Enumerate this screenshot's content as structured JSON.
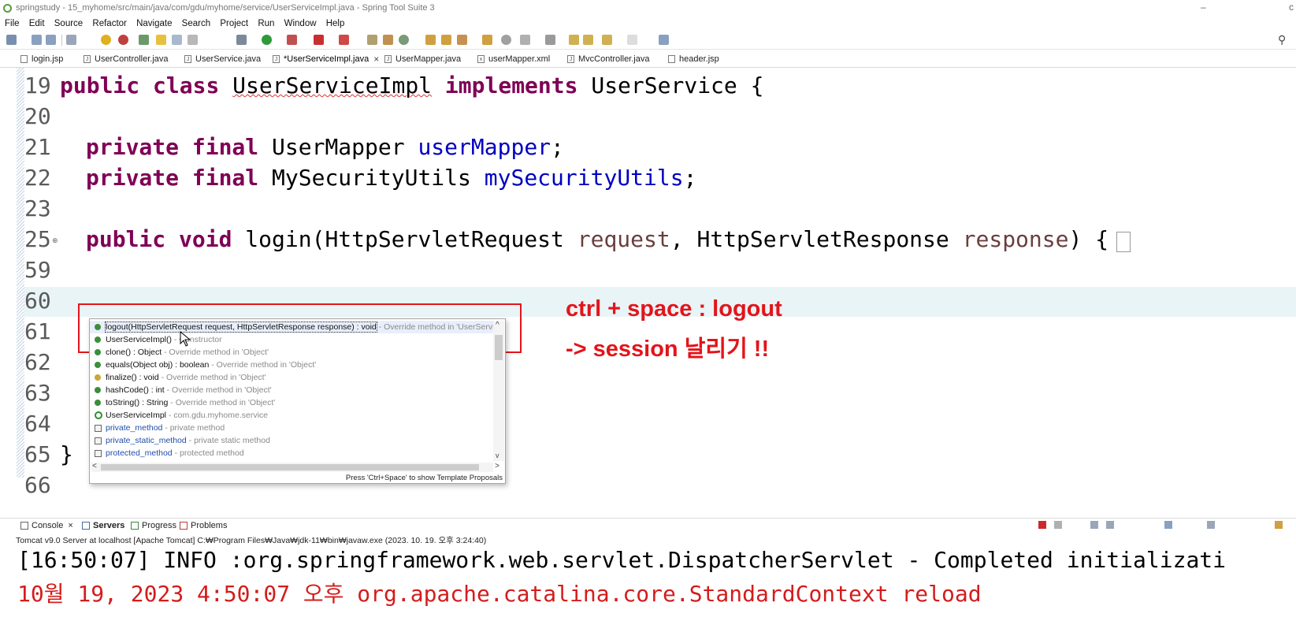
{
  "window": {
    "title": "springstudy - 15_myhome/src/main/java/com/gdu/myhome/service/UserServiceImpl.java - Spring Tool Suite 3",
    "minimize_glyph": "–",
    "restore_glyph": "c"
  },
  "menu": [
    "File",
    "Edit",
    "Source",
    "Refactor",
    "Navigate",
    "Search",
    "Project",
    "Run",
    "Window",
    "Help"
  ],
  "tabs": [
    {
      "label": "login.jsp"
    },
    {
      "label": "UserController.java"
    },
    {
      "label": "UserService.java"
    },
    {
      "label": "*UserServiceImpl.java",
      "close": "×"
    },
    {
      "label": "UserMapper.java"
    },
    {
      "label": "userMapper.xml"
    },
    {
      "label": "MvcController.java"
    },
    {
      "label": "header.jsp"
    }
  ],
  "editor": {
    "lines": [
      {
        "num": "19"
      },
      {
        "num": "20"
      },
      {
        "num": "21"
      },
      {
        "num": "22"
      },
      {
        "num": "23"
      },
      {
        "num": "25"
      },
      {
        "num": "59"
      },
      {
        "num": "60"
      },
      {
        "num": "61"
      },
      {
        "num": "62"
      },
      {
        "num": "63"
      },
      {
        "num": "64"
      },
      {
        "num": "65"
      },
      {
        "num": "66"
      }
    ],
    "code": {
      "l19": {
        "kw1": "public",
        "kw2": "class",
        "cls": "UserServiceImpl",
        "kw3": "implements",
        "rest": "UserService {"
      },
      "l21": {
        "kw": "private final",
        "type": "UserMapper",
        "field": "userMapper",
        "end": ";"
      },
      "l22": {
        "kw": "private final",
        "type": "MySecurityUtils",
        "field": "mySecurityUtils",
        "end": ";"
      },
      "l25": {
        "kw": "public void",
        "m": "login(HttpServletRequest",
        "p1": "request",
        "m2": ", HttpServletResponse",
        "p2": "response",
        "end": ") {"
      },
      "l65": {
        "text": "}"
      }
    }
  },
  "annotation": {
    "line1": "ctrl + space : logout",
    "line2": "-> session 날리기 !!",
    "color": "#e3141a"
  },
  "completion": {
    "items": [
      {
        "text": "logout(HttpServletRequest request, HttpServletResponse response) : void",
        "desc": " - Override method in 'UserService'",
        "icon": "method-override-icon",
        "color": "#3a8f3a"
      },
      {
        "text": "UserServiceImpl()",
        "desc": " - Constructor",
        "icon": "constructor-icon",
        "color": "#3a8f3a"
      },
      {
        "text": "clone() : Object",
        "desc": " - Override method in 'Object'",
        "icon": "method-icon",
        "color": "#3a8f3a"
      },
      {
        "text": "equals(Object obj) : boolean",
        "desc": " - Override method in 'Object'",
        "icon": "method-icon",
        "color": "#3a8f3a"
      },
      {
        "text": "finalize() : void",
        "desc": " - Override method in 'Object'",
        "icon": "method-icon",
        "color": "#c8a83a"
      },
      {
        "text": "hashCode() : int",
        "desc": " - Override method in 'Object'",
        "icon": "method-icon",
        "color": "#3a8f3a"
      },
      {
        "text": "toString() : String",
        "desc": " - Override method in 'Object'",
        "icon": "method-icon",
        "color": "#3a8f3a"
      },
      {
        "text": "UserServiceImpl",
        "desc": " - com.gdu.myhome.service",
        "icon": "class-icon",
        "color": "#2f8f2f"
      },
      {
        "text": "private_method",
        "desc": " - private method",
        "icon": "template-icon",
        "color": "#999999"
      },
      {
        "text": "private_static_method",
        "desc": " - private static method",
        "icon": "template-icon",
        "color": "#999999"
      },
      {
        "text": "protected_method",
        "desc": " - protected method",
        "icon": "template-icon",
        "color": "#999999"
      }
    ],
    "hint": "Press 'Ctrl+Space' to show Template Proposals",
    "scroll_up": "^",
    "scroll_down": "v",
    "scroll_left": "<",
    "scroll_right": ">"
  },
  "console": {
    "tabs": [
      {
        "label": "Console"
      },
      {
        "label": "Servers"
      },
      {
        "label": "Progress"
      },
      {
        "label": "Problems"
      }
    ],
    "close": "×",
    "server_info": "Tomcat v9.0 Server at localhost [Apache Tomcat] C:₩Program Files₩Java₩jdk-11₩bin₩javaw.exe  (2023. 10. 19. 오후 3:24:40)",
    "lines": [
      {
        "text": "[16:50:07] INFO :org.springframework.web.servlet.DispatcherServlet - Completed initializati",
        "color": "#000000"
      },
      {
        "text": "10월 19, 2023 4:50:07 오후 org.apache.catalina.core.StandardContext reload",
        "color": "#d41c1c"
      }
    ]
  }
}
